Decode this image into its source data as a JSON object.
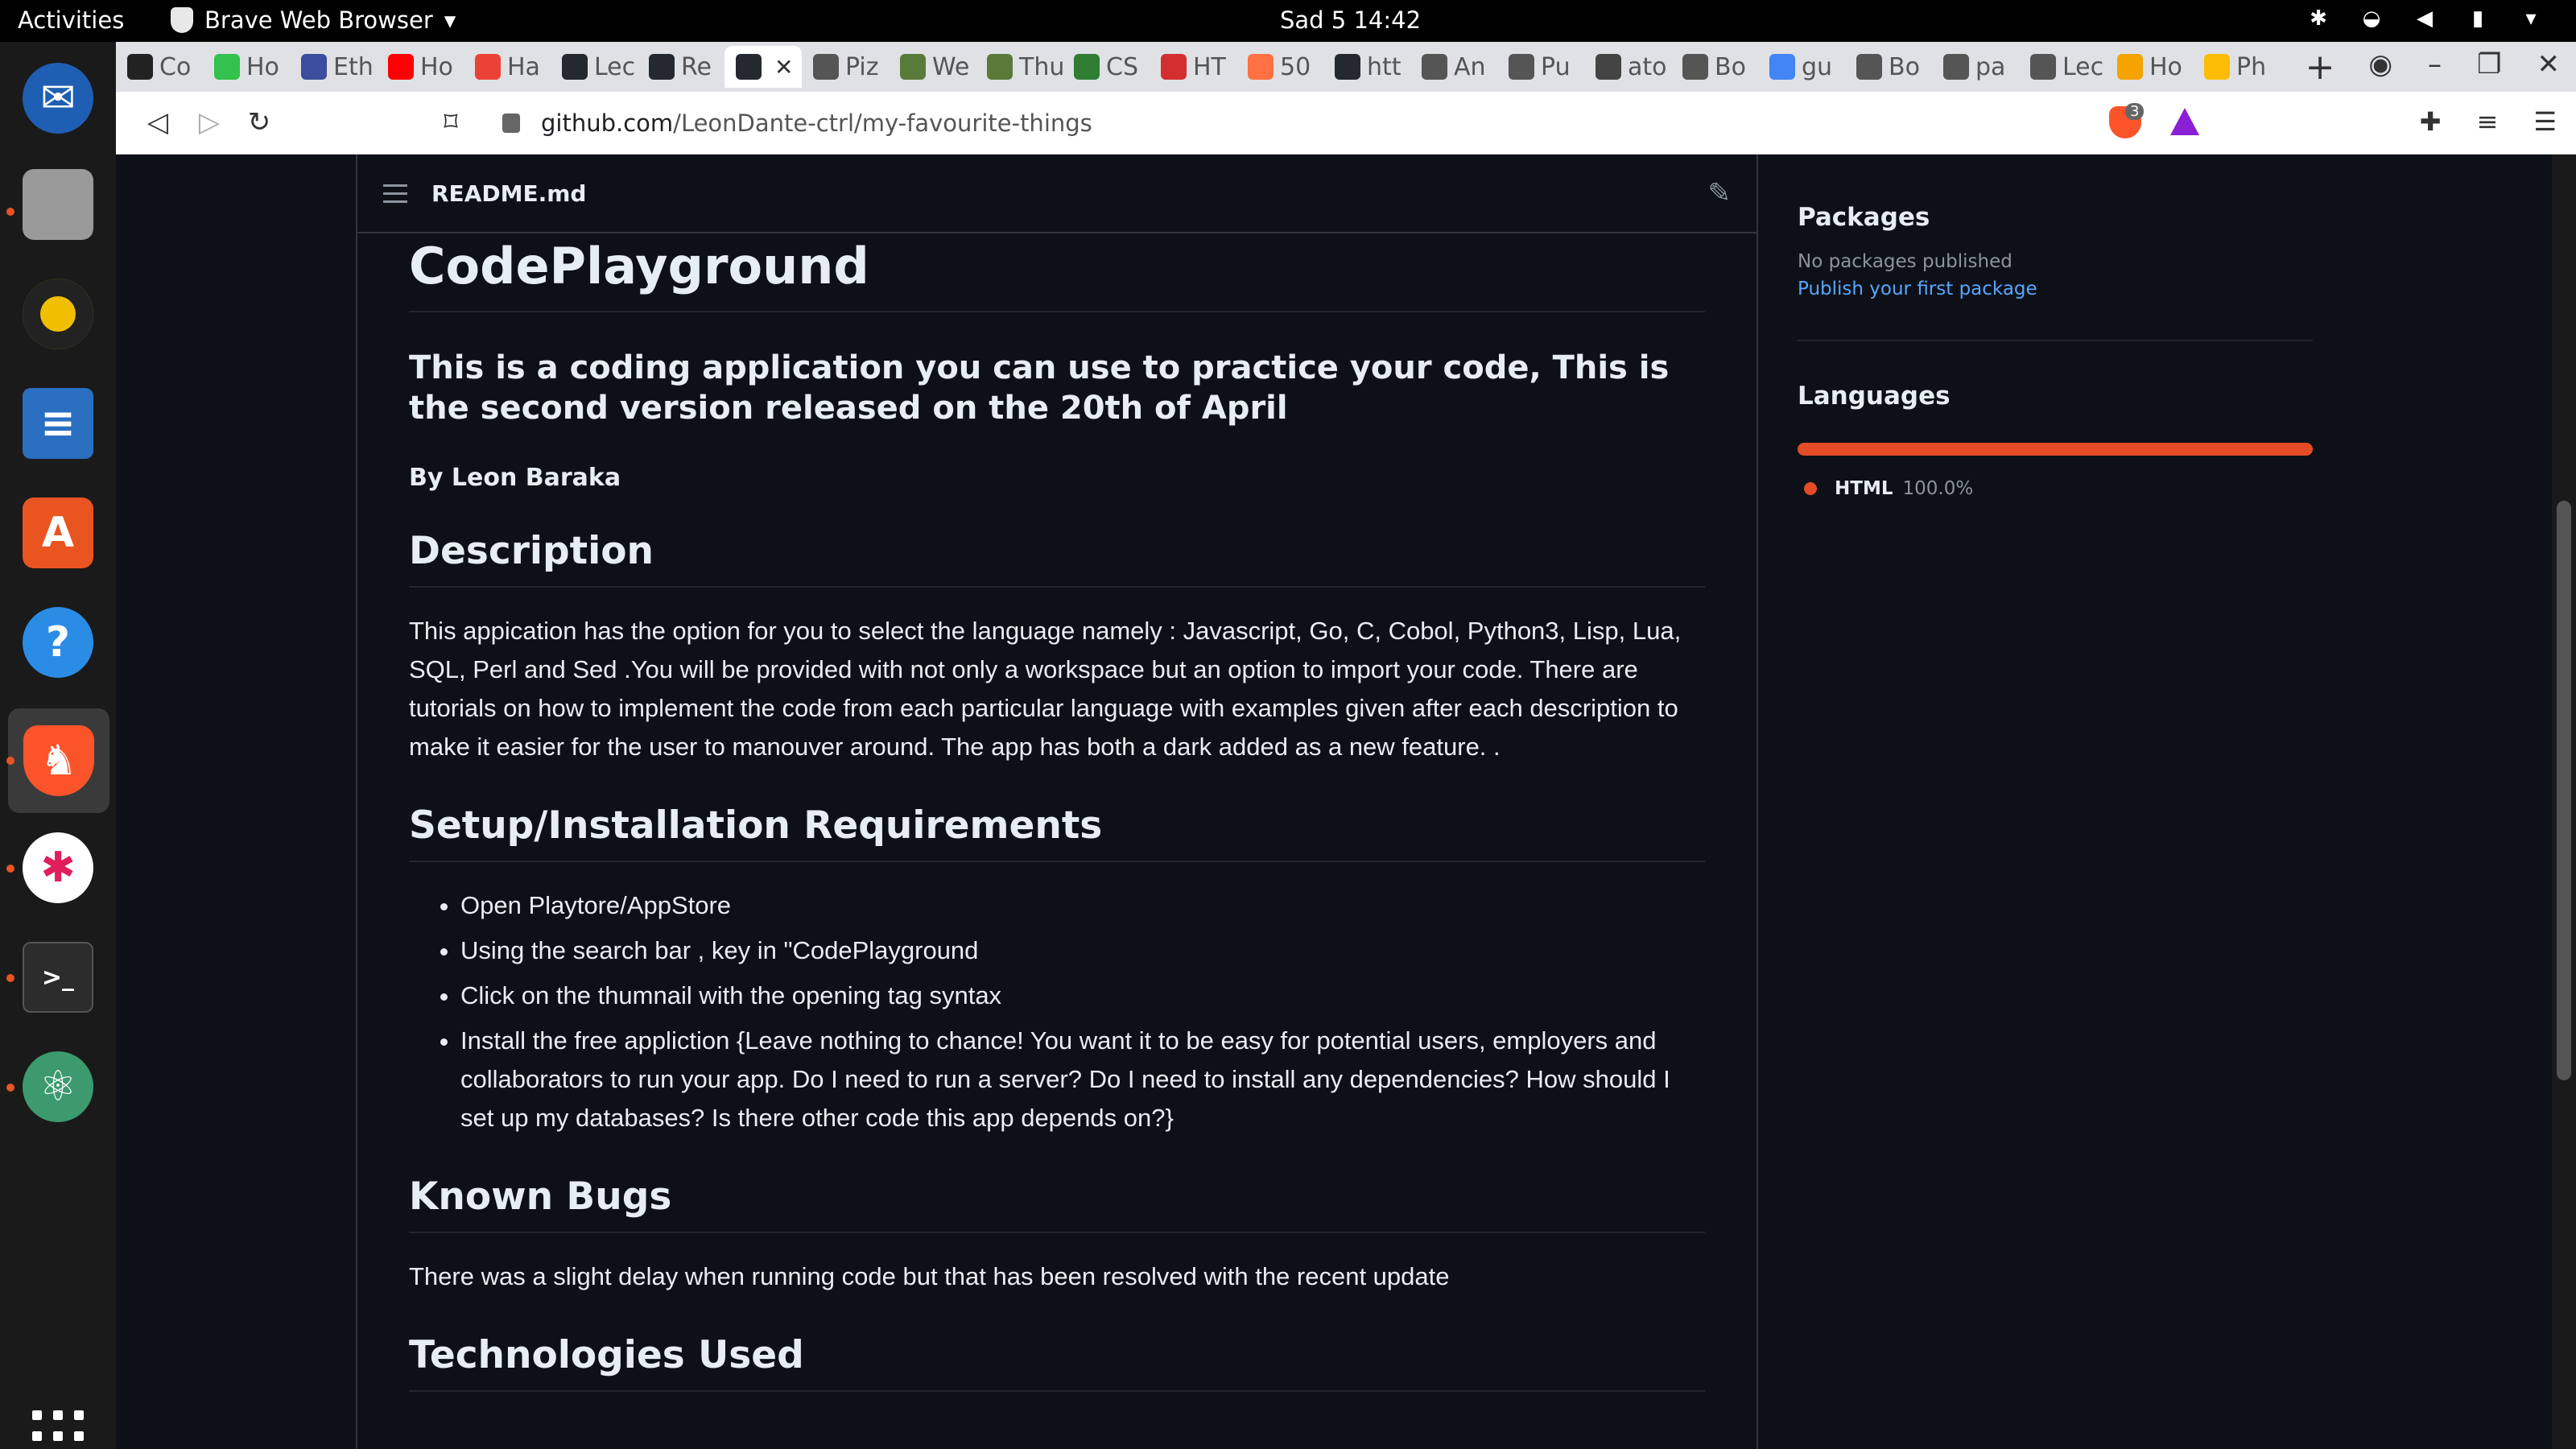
{
  "topbar": {
    "activities": "Activities",
    "app_name": "Brave Web Browser",
    "clock": "Sad 5  14:42"
  },
  "tabs": [
    {
      "label": "Co",
      "color": "#222"
    },
    {
      "label": "Ho",
      "color": "#32c24d"
    },
    {
      "label": "Eth",
      "color": "#3b4d9c"
    },
    {
      "label": "Ho",
      "color": "#ff0000"
    },
    {
      "label": "Ha",
      "color": "#ea4335"
    },
    {
      "label": "Lec",
      "color": "#24292f"
    },
    {
      "label": "Re",
      "color": "#24292f"
    },
    {
      "label": "",
      "color": "#24292f"
    },
    {
      "label": "Piz",
      "color": "#555"
    },
    {
      "label": "We",
      "color": "#5a7a3a"
    },
    {
      "label": "Thu",
      "color": "#5a7a3a"
    },
    {
      "label": "CS",
      "color": "#2e7d32"
    },
    {
      "label": "HT",
      "color": "#d32f2f"
    },
    {
      "label": "50",
      "color": "#ff7043"
    },
    {
      "label": "htt",
      "color": "#24292f"
    },
    {
      "label": "An",
      "color": "#555"
    },
    {
      "label": "Pu",
      "color": "#555"
    },
    {
      "label": "ato",
      "color": "#444"
    },
    {
      "label": "Bo",
      "color": "#555"
    },
    {
      "label": "gu",
      "color": "#4285f4"
    },
    {
      "label": "Bo",
      "color": "#555"
    },
    {
      "label": "pa",
      "color": "#555"
    },
    {
      "label": "Lec",
      "color": "#555"
    },
    {
      "label": "Ho",
      "color": "#f4a300"
    },
    {
      "label": "Ph",
      "color": "#fbbc04"
    }
  ],
  "address": {
    "host": "github.com",
    "path": "/LeonDante-ctrl/my-favourite-things",
    "shield_count": "3"
  },
  "readme": {
    "filename": "README.md",
    "title": "CodePlayground",
    "subtitle": "This is a coding application you can use to practice your code, This is the second version released on the 20th of April",
    "author": "By Leon Baraka",
    "description_heading": "Description",
    "description": "This appication has the option for you to select the language namely : Javascript, Go, C, Cobol, Python3, Lisp, Lua, SQL, Perl and Sed .You will be provided with not only a workspace but an option to import your code. There are tutorials on how to implement the code from each particular language with examples given after each description to make it easier for the user to manouver around. The app has both a dark added as a new feature. .",
    "setup_heading": "Setup/Installation Requirements",
    "setup_steps": [
      "Open Playtore/AppStore",
      "Using the search bar , key in \"CodePlayground",
      "Click on the thumnail with the opening tag syntax",
      "Install the free appliction {Leave nothing to chance! You want it to be easy for potential users, employers and collaborators to run your app. Do I need to run a server? Do I need to install any dependencies? How should I set up my databases? Is there other code this app depends on?}"
    ],
    "bugs_heading": "Known Bugs",
    "bugs": "There was a slight delay when running code but that has been resolved with the recent update",
    "tech_heading": "Technologies Used"
  },
  "sidebar": {
    "packages_heading": "Packages",
    "packages_none": "No packages published",
    "packages_link": "Publish your first package",
    "languages_heading": "Languages",
    "languages": [
      {
        "name": "HTML",
        "percent": "100.0%",
        "fraction": 1.0,
        "color": "#e34c26"
      }
    ]
  },
  "dock": {
    "icons": [
      "thunderbird-icon",
      "files-icon",
      "rhythmbox-icon",
      "writer-icon",
      "software-icon",
      "help-icon",
      "brave-icon",
      "slack-icon",
      "terminal-icon",
      "atom-icon"
    ]
  }
}
